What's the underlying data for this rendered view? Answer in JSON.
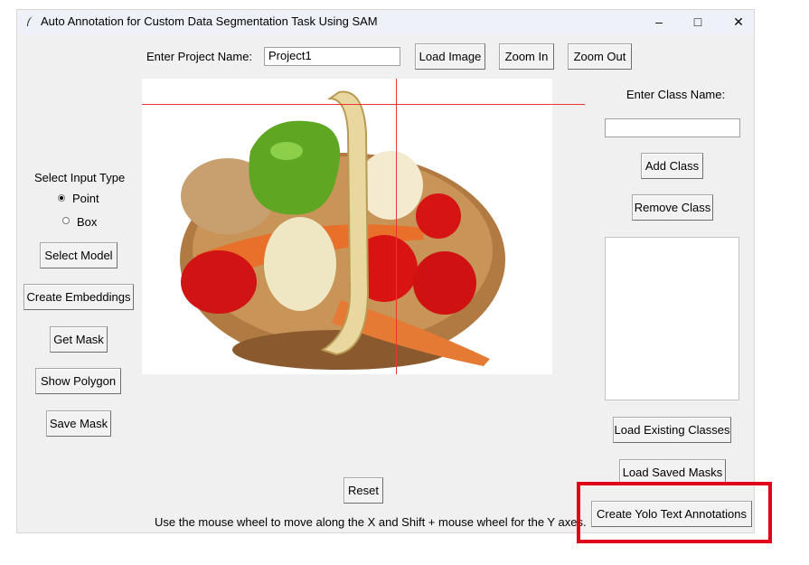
{
  "window": {
    "title": "Auto Annotation for Custom Data Segmentation Task Using SAM",
    "minimize_glyph": "–",
    "maximize_glyph": "□",
    "close_glyph": "✕",
    "app_icon": "feather-icon"
  },
  "top_bar": {
    "project_label": "Enter Project Name:",
    "project_value": "Project1",
    "load_image": "Load Image",
    "zoom_in": "Zoom In",
    "zoom_out": "Zoom Out"
  },
  "left_panel": {
    "input_type_label": "Select Input Type",
    "options": [
      {
        "label": "Point",
        "selected": true
      },
      {
        "label": "Box",
        "selected": false
      }
    ],
    "select_model": "Select Model",
    "create_embeddings": "Create Embeddings",
    "get_mask": "Get Mask",
    "show_polygon": "Show Polygon",
    "save_mask": "Save Mask"
  },
  "right_panel": {
    "class_name_label": "Enter Class Name:",
    "class_name_value": "",
    "add_class": "Add Class",
    "remove_class": "Remove Class",
    "class_list": [],
    "load_existing_classes": "Load Existing Classes",
    "load_saved_masks": "Load Saved Masks",
    "create_yolo": "Create Yolo Text Annotations"
  },
  "canvas": {
    "image_subject": "vegetable-basket-image",
    "crosshair_color": "#e33333"
  },
  "bottom": {
    "reset": "Reset",
    "hint": "Use the mouse wheel to move along the X and Shift + mouse wheel for the Y axes."
  },
  "highlight": {
    "color": "#e0001a",
    "target": "create-yolo-button"
  }
}
